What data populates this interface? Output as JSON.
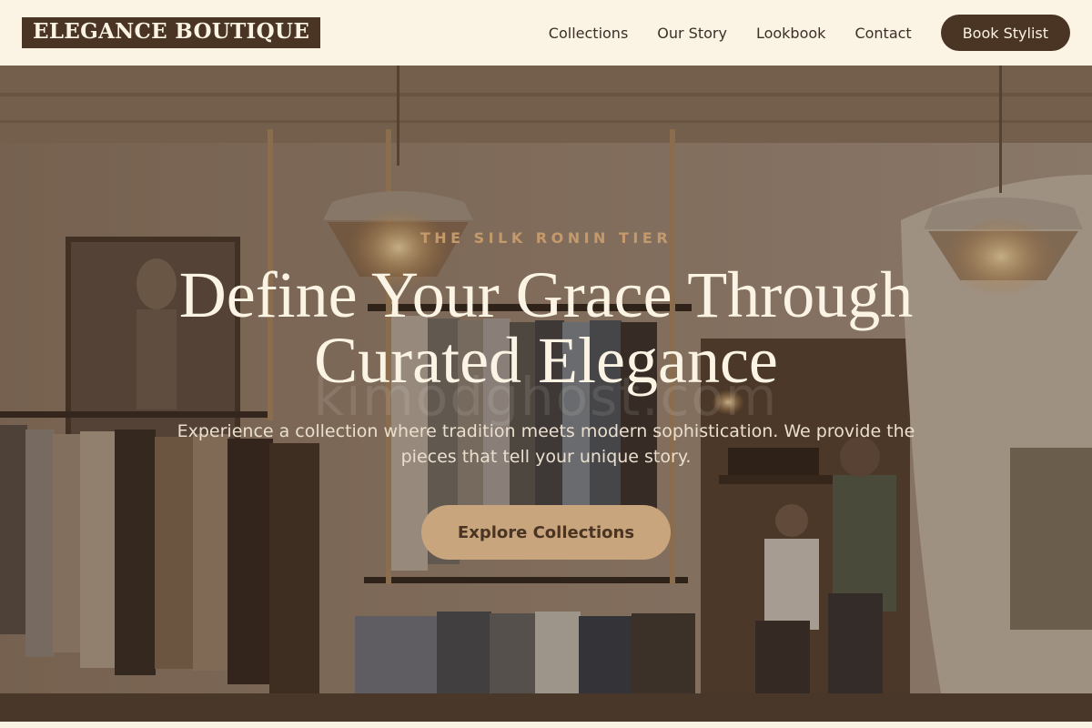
{
  "brand": {
    "name": "ELEGANCE BOUTIQUE"
  },
  "nav": {
    "links": [
      {
        "label": "Collections"
      },
      {
        "label": "Our Story"
      },
      {
        "label": "Lookbook"
      },
      {
        "label": "Contact"
      }
    ],
    "cta_label": "Book Stylist"
  },
  "hero": {
    "eyebrow": "THE SILK RONIN TIER",
    "headline_line1": "Define Your Grace Through",
    "headline_line2": "Curated Elegance",
    "subtext": "Experience a collection where tradition meets modern sophistication. We provide the pieces that tell your unique story.",
    "button_label": "Explore Collections",
    "watermark": "kimodghost.com"
  },
  "colors": {
    "brand_dark": "#4a3424",
    "cream": "#fbf4e4",
    "accent_tan": "#c8a57c",
    "eyebrow": "#c49a6c"
  }
}
